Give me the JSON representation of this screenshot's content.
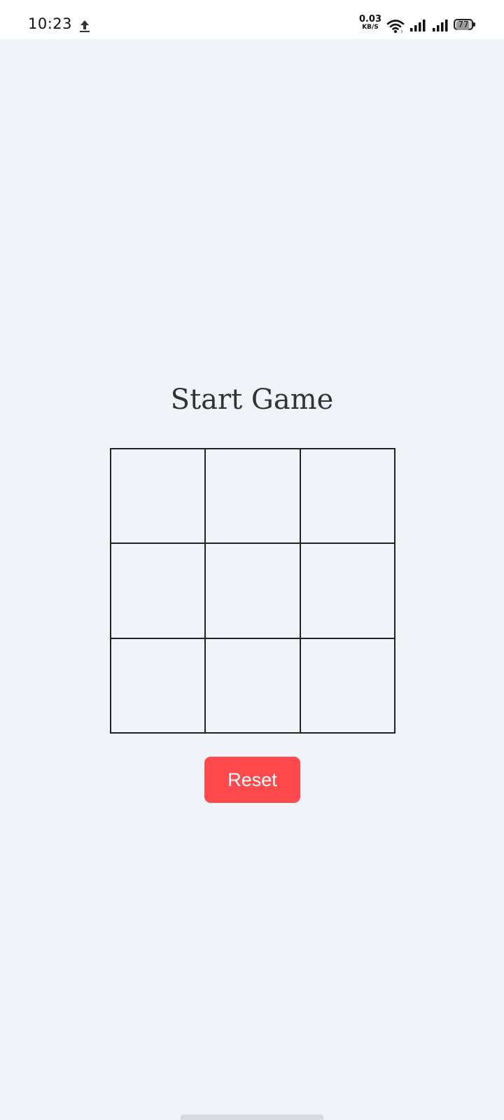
{
  "status_bar": {
    "time": "10:23",
    "net_speed_value": "0.03",
    "net_speed_unit": "KB/S",
    "battery_percent": "77",
    "battery_level": 0.77
  },
  "game": {
    "title": "Start Game",
    "board": [
      "",
      "",
      "",
      "",
      "",
      "",
      "",
      "",
      ""
    ],
    "reset_label": "Reset"
  },
  "colors": {
    "background": "#f0f3f8",
    "reset_button": "#ff4a4d",
    "title_text": "#333333",
    "grid_lines": "#222222"
  },
  "icons": {
    "upload": "upload-icon",
    "wifi": "wifi-icon",
    "signal": "signal-icon",
    "battery": "battery-icon"
  }
}
